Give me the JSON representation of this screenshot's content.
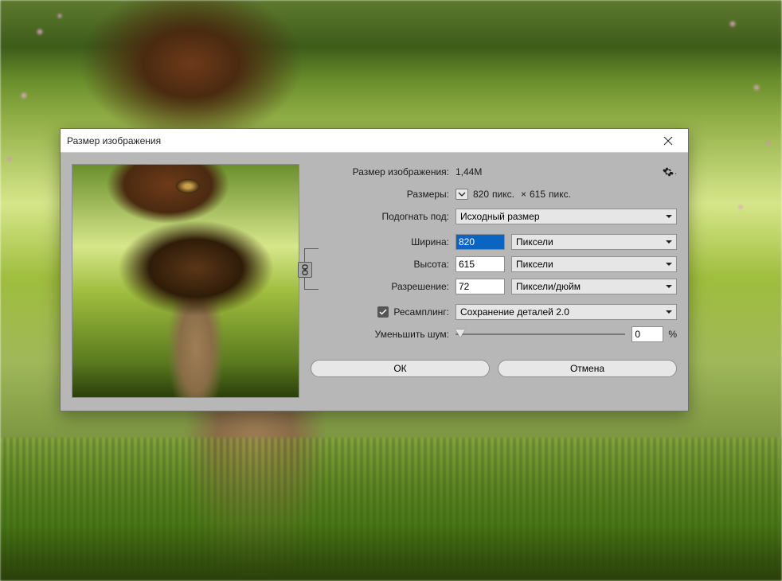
{
  "dialog": {
    "title": "Размер изображения",
    "size_label": "Размер изображения:",
    "size_value": "1,44M",
    "dims_label": "Размеры:",
    "dims_expanded": true,
    "dims_width": "820",
    "dims_height": "615",
    "dims_unit": "пикс.",
    "fit_label": "Подогнать под:",
    "fit_value": "Исходный размер",
    "width_label": "Ширина:",
    "width_value": "820",
    "width_unit": "Пиксели",
    "height_label": "Высота:",
    "height_value": "615",
    "height_unit": "Пиксели",
    "res_label": "Разрешение:",
    "res_value": "72",
    "res_unit": "Пиксели/дюйм",
    "resample_label": "Ресамплинг:",
    "resample_checked": true,
    "resample_method": "Сохранение деталей 2.0",
    "noise_label": "Уменьшить шум:",
    "noise_value": "0",
    "noise_suffix": "%",
    "ok_label": "ОК",
    "cancel_label": "Отмена"
  }
}
